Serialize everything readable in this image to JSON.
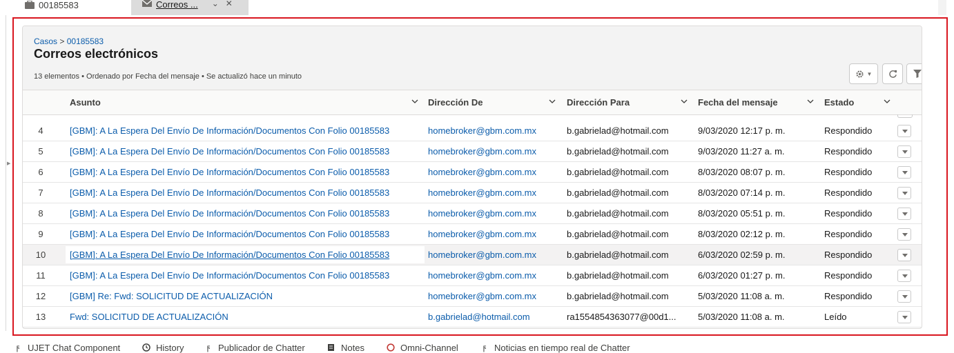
{
  "tabs": [
    {
      "label": "00185583",
      "icon": "case-icon"
    },
    {
      "label": "Correos ...",
      "icon": "email-icon"
    }
  ],
  "card": {
    "breadcrumb": {
      "parent": "Casos",
      "separator": ">",
      "current": "00185583"
    },
    "title": "Correos electrónicos",
    "subinfo": "13 elementos • Ordenado por Fecha del mensaje • Se actualizó hace un minuto"
  },
  "columns": {
    "subject": "Asunto",
    "from": "Dirección De",
    "to": "Dirección Para",
    "date": "Fecha del mensaje",
    "status": "Estado"
  },
  "rows": [
    {
      "num": "4",
      "subject": "[GBM]: A La Espera Del Envío De Información/Documentos Con Folio 00185583",
      "from": "homebroker@gbm.com.mx",
      "to": "b.gabrielad@hotmail.com",
      "date": "9/03/2020 12:17 p. m.",
      "status": "Respondido"
    },
    {
      "num": "5",
      "subject": "[GBM]: A La Espera Del Envío De Información/Documentos Con Folio 00185583",
      "from": "homebroker@gbm.com.mx",
      "to": "b.gabrielad@hotmail.com",
      "date": "9/03/2020 11:27 a. m.",
      "status": "Respondido"
    },
    {
      "num": "6",
      "subject": "[GBM]: A La Espera Del Envío De Información/Documentos Con Folio 00185583",
      "from": "homebroker@gbm.com.mx",
      "to": "b.gabrielad@hotmail.com",
      "date": "8/03/2020 08:07 p. m.",
      "status": "Respondido"
    },
    {
      "num": "7",
      "subject": "[GBM]: A La Espera Del Envío De Información/Documentos Con Folio 00185583",
      "from": "homebroker@gbm.com.mx",
      "to": "b.gabrielad@hotmail.com",
      "date": "8/03/2020 07:14 p. m.",
      "status": "Respondido"
    },
    {
      "num": "8",
      "subject": "[GBM]: A La Espera Del Envío De Información/Documentos Con Folio 00185583",
      "from": "homebroker@gbm.com.mx",
      "to": "b.gabrielad@hotmail.com",
      "date": "8/03/2020 05:51 p. m.",
      "status": "Respondido"
    },
    {
      "num": "9",
      "subject": "[GBM]: A La Espera Del Envío De Información/Documentos Con Folio 00185583",
      "from": "homebroker@gbm.com.mx",
      "to": "b.gabrielad@hotmail.com",
      "date": "8/03/2020 02:12 p. m.",
      "status": "Respondido"
    },
    {
      "num": "10",
      "subject": "[GBM]: A La Espera Del Envío De Información/Documentos Con Folio 00185583",
      "from": "homebroker@gbm.com.mx",
      "to": "b.gabrielad@hotmail.com",
      "date": "6/03/2020 02:59 p. m.",
      "status": "Respondido",
      "selected": true
    },
    {
      "num": "11",
      "subject": "[GBM]: A La Espera Del Envío De Información/Documentos Con Folio 00185583",
      "from": "homebroker@gbm.com.mx",
      "to": "b.gabrielad@hotmail.com",
      "date": "6/03/2020 01:27 p. m.",
      "status": "Respondido"
    },
    {
      "num": "12",
      "subject": "[GBM] Re: Fwd: SOLICITUD DE ACTUALIZACIÓN",
      "from": "homebroker@gbm.com.mx",
      "to": "b.gabrielad@hotmail.com",
      "date": "5/03/2020 11:08 a. m.",
      "status": "Respondido"
    },
    {
      "num": "13",
      "subject": "Fwd: SOLICITUD DE ACTUALIZACIÓN",
      "from": "b.gabrielad@hotmail.com",
      "to": "ra1554854363077@00d1...",
      "date": "5/03/2020 11:08 a. m.",
      "status": "Leído"
    }
  ],
  "footer": [
    {
      "label": "UJET Chat Component",
      "icon": "lightning-icon"
    },
    {
      "label": "History",
      "icon": "clock-icon"
    },
    {
      "label": "Publicador de Chatter",
      "icon": "lightning-icon"
    },
    {
      "label": "Notes",
      "icon": "note-icon"
    },
    {
      "label": "Omni-Channel",
      "icon": "status-circle-icon"
    },
    {
      "label": "Noticias en tiempo real de Chatter",
      "icon": "lightning-icon"
    }
  ],
  "colors": {
    "link": "#0b5cab",
    "frame": "#d9161f",
    "omni_status": "#c23934"
  }
}
